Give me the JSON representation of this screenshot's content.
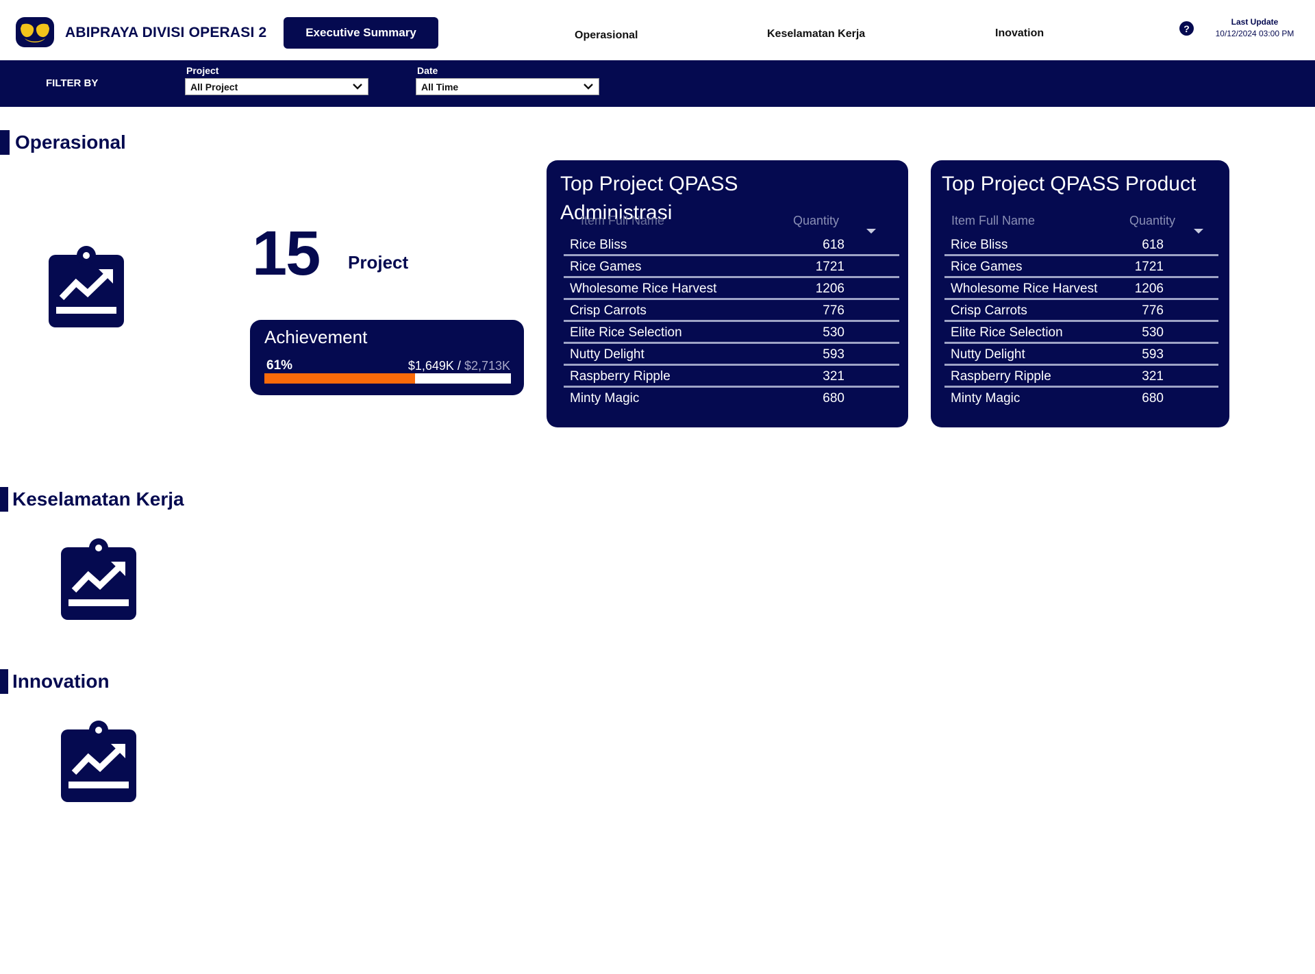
{
  "header": {
    "brand": "ABIPRAYA DIVISI OPERASI 2",
    "nav": {
      "active": "Executive Summary",
      "operasional": "Operasional",
      "keselamatan": "Keselamatan Kerja",
      "inovation": "Inovation"
    },
    "help_glyph": "?",
    "last_update_label": "Last Update",
    "last_update_value": "10/12/2024 03:00 PM"
  },
  "filters": {
    "label": "FILTER BY",
    "project": {
      "label": "Project",
      "value": "All Project"
    },
    "date": {
      "label": "Date",
      "value": "All Time"
    }
  },
  "sections": {
    "operasional": "Operasional",
    "keselamatan": "Keselamatan Kerja",
    "innovation": "Innovation"
  },
  "kpi": {
    "project_count": "15",
    "project_label": "Project"
  },
  "achievement": {
    "title": "Achievement",
    "percent_text": "61%",
    "percent_value": 0.61,
    "actual": "$1,649K",
    "separator": " / ",
    "target": "$2,713K"
  },
  "tables": [
    {
      "title_line1": "Top Project QPASS",
      "title_line2": "Administrasi",
      "col_name": "Item Full Name",
      "col_qty": "Quantity",
      "rows": [
        {
          "name": "Rice Bliss",
          "qty": "618"
        },
        {
          "name": "Rice Games",
          "qty": "1721"
        },
        {
          "name": "Wholesome Rice Harvest",
          "qty": "1206"
        },
        {
          "name": "Crisp Carrots",
          "qty": "776"
        },
        {
          "name": "Elite Rice Selection",
          "qty": "530"
        },
        {
          "name": "Nutty Delight",
          "qty": "593"
        },
        {
          "name": "Raspberry Ripple",
          "qty": "321"
        },
        {
          "name": "Minty Magic",
          "qty": "680"
        }
      ]
    },
    {
      "title_line1": "Top Project QPASS Product",
      "col_name": "Item Full Name",
      "col_qty": "Quantity",
      "rows": [
        {
          "name": "Rice Bliss",
          "qty": "618"
        },
        {
          "name": "Rice Games",
          "qty": "1721"
        },
        {
          "name": "Wholesome Rice Harvest",
          "qty": "1206"
        },
        {
          "name": "Crisp Carrots",
          "qty": "776"
        },
        {
          "name": "Elite Rice Selection",
          "qty": "530"
        },
        {
          "name": "Nutty Delight",
          "qty": "593"
        },
        {
          "name": "Raspberry Ripple",
          "qty": "321"
        },
        {
          "name": "Minty Magic",
          "qty": "680"
        }
      ]
    }
  ],
  "icons": {
    "logo": "brand-logo-icon",
    "clipboard": "clipboard-chart-icon",
    "chevron": "chevron-down-icon",
    "help": "help-icon",
    "sort": "sort-caret-icon"
  },
  "colors": {
    "navy": "#050a50",
    "accent_orange": "#fa6a0a",
    "logo_yellow": "#f2c31b"
  }
}
